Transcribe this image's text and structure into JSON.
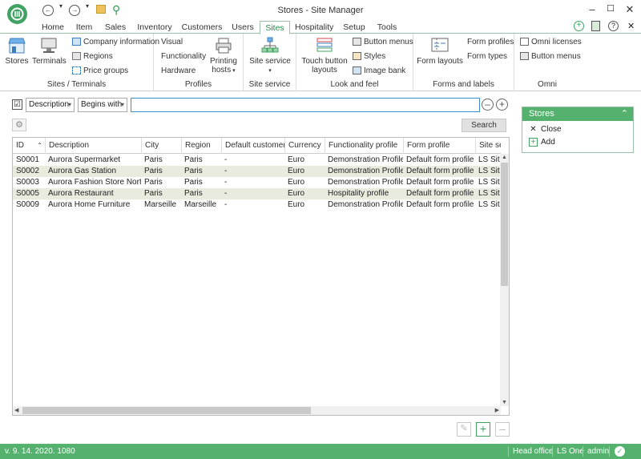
{
  "window": {
    "title": "Stores - Site Manager"
  },
  "menu_tabs": [
    "Home",
    "Item",
    "Sales",
    "Inventory",
    "Customers",
    "Users",
    "Sites",
    "Hospitality",
    "Setup",
    "Tools"
  ],
  "active_tab": "Sites",
  "ribbon": {
    "sites_terminals": {
      "label": "Sites / Terminals",
      "stores": "Stores",
      "terminals": "Terminals",
      "company_info": "Company information",
      "regions": "Regions",
      "price_groups": "Price groups"
    },
    "profiles": {
      "label": "Profiles",
      "visual": "Visual",
      "functionality": "Functionality",
      "hardware": "Hardware",
      "printing_hosts_1": "Printing",
      "printing_hosts_2": "hosts"
    },
    "site_service": {
      "label": "Site service",
      "site_service": "Site service"
    },
    "look_feel": {
      "label": "Look and feel",
      "touch_1": "Touch button",
      "touch_2": "layouts",
      "button_menus": "Button menus",
      "styles": "Styles",
      "image_bank": "Image bank"
    },
    "forms_labels": {
      "label": "Forms and labels",
      "form_layouts": "Form layouts",
      "form_profiles": "Form profiles",
      "form_types": "Form types"
    },
    "omni": {
      "label": "Omni",
      "omni_licenses": "Omni licenses",
      "button_menus": "Button menus"
    }
  },
  "filter": {
    "checked": "☑",
    "field": "Description",
    "operator": "Begins with",
    "value": ""
  },
  "search_button": "Search",
  "grid": {
    "columns": [
      "ID",
      "Description",
      "City",
      "Region",
      "Default customer",
      "Currency",
      "Functionality profile",
      "Form profile",
      "Site servic"
    ],
    "rows": [
      [
        "S0001",
        "Aurora Supermarket",
        "Paris",
        "Paris",
        "-",
        "Euro",
        "Demonstration Profile",
        "Default form profile",
        "LS Site"
      ],
      [
        "S0002",
        "Aurora Gas Station",
        "Paris",
        "Paris",
        "-",
        "Euro",
        "Demonstration Profile",
        "Default form profile",
        "LS Site"
      ],
      [
        "S0003",
        "Aurora Fashion Store North",
        "Paris",
        "Paris",
        "-",
        "Euro",
        "Demonstration Profile",
        "Default form profile",
        "LS Site"
      ],
      [
        "S0005",
        "Aurora Restaurant",
        "Paris",
        "Paris",
        "-",
        "Euro",
        "Hospitality profile",
        "Default form profile",
        "LS Site"
      ],
      [
        "S0009",
        "Aurora Home Furniture",
        "Marseille",
        "Marseille",
        "-",
        "Euro",
        "Demonstration Profile",
        "Default form profile",
        "LS Site"
      ]
    ]
  },
  "side_panel": {
    "title": "Stores",
    "close": "Close",
    "add": "Add"
  },
  "status": {
    "version": "v. 9. 14. 2020. 1080",
    "site": "Head office",
    "product": "LS One",
    "user": "admin"
  },
  "colors": {
    "accent": "#54b26e",
    "tab_active": "#2a8a4a",
    "alt_row": "#e8ebde",
    "filter_focus": "#3c8fcd"
  }
}
